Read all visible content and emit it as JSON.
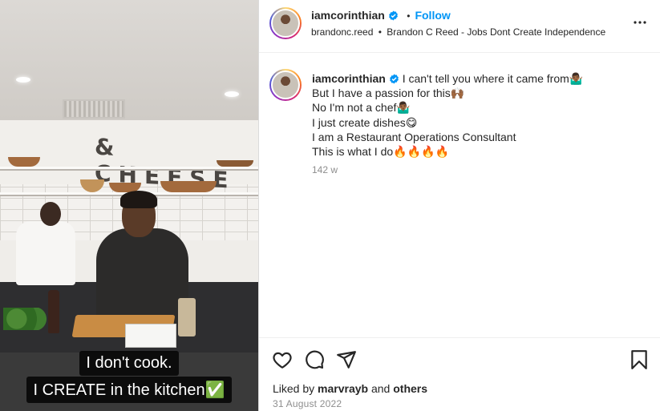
{
  "media": {
    "sign_text": "& CHEESE",
    "caption_line1": "I don't cook.",
    "caption_line2": "I CREATE in the kitchen✅"
  },
  "header": {
    "username": "iamcorinthian",
    "follow_label": "Follow",
    "separator": "•",
    "audio_account": "brandonc.reed",
    "audio_title": "Brandon C Reed - Jobs Dont Create Independence",
    "more_label": "•••"
  },
  "post_caption": {
    "username": "iamcorinthian",
    "lines": [
      "I can't tell you where it came from🤷🏾‍♂️",
      "But I have a passion for this🙌🏾",
      "No I'm not a chef🤷🏾‍♂️",
      "I just create dishes😋",
      "I am a Restaurant Operations Consultant",
      "This is what I do🔥🔥🔥🔥"
    ],
    "time_ago": "142 w"
  },
  "footer": {
    "liked_by_prefix": "Liked by ",
    "liked_by_user": "marvrayb",
    "liked_by_and": " and ",
    "liked_by_others": "others",
    "date": "31 August 2022"
  },
  "colors": {
    "accent": "#0095f6",
    "text": "#262626",
    "muted": "#8e8e8e"
  },
  "icons": [
    "heart-icon",
    "comment-icon",
    "share-icon",
    "bookmark-icon",
    "verified-badge-icon",
    "more-options-icon"
  ]
}
